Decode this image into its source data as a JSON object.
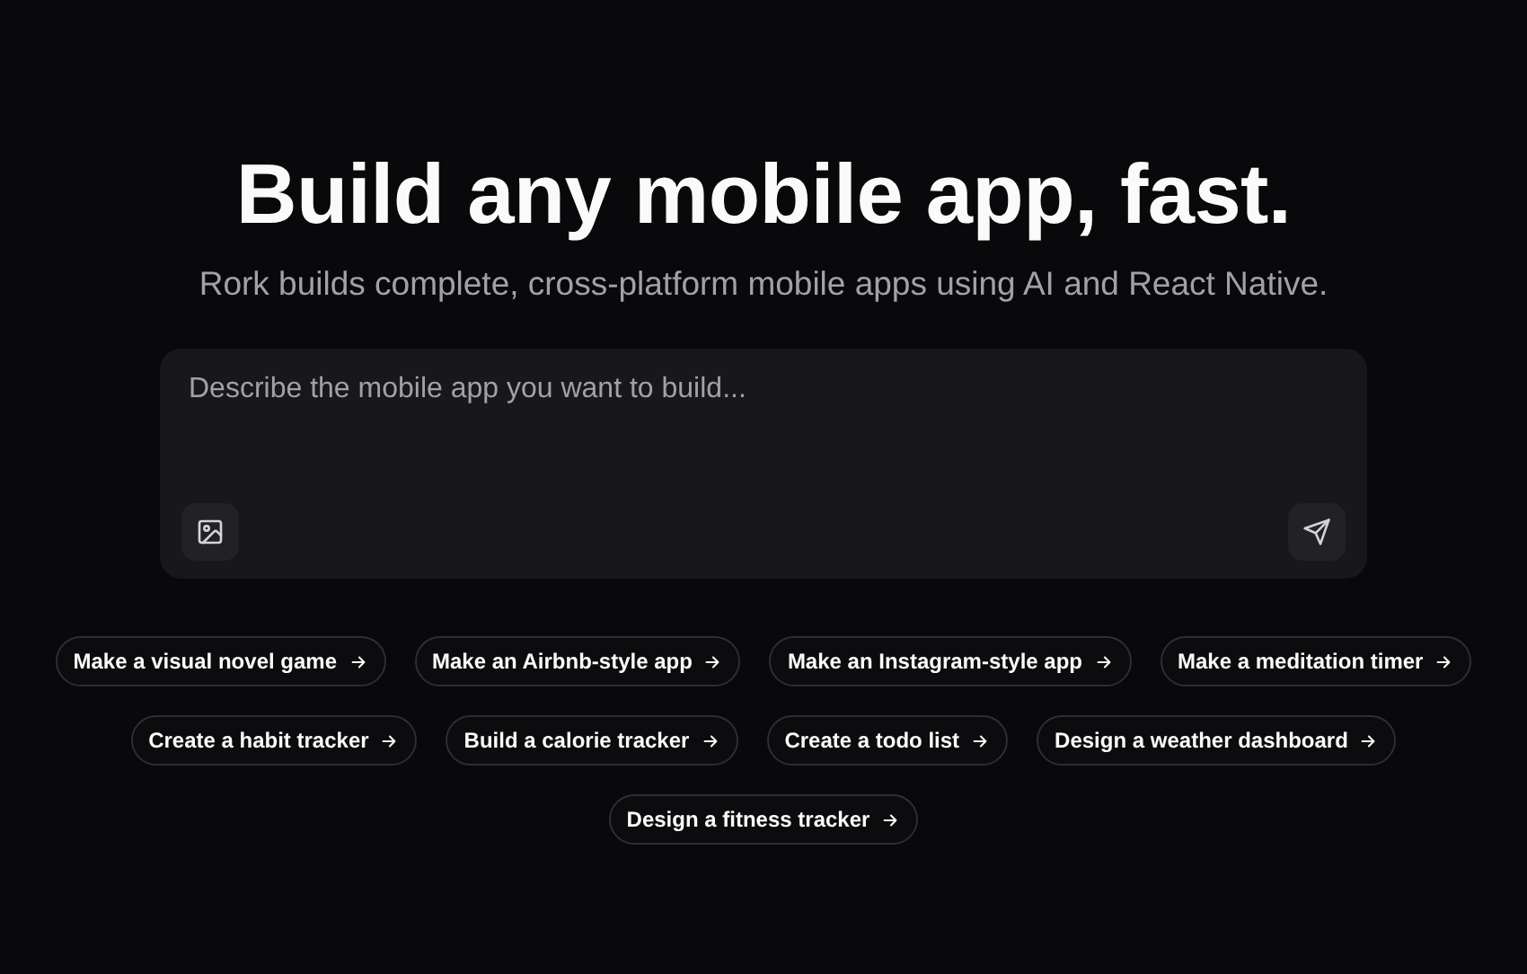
{
  "hero": {
    "title": "Build any mobile app, fast.",
    "subtitle": "Rork builds complete, cross-platform mobile apps using AI and React Native."
  },
  "prompt": {
    "placeholder": "Describe the mobile app you want to build..."
  },
  "suggestions": [
    {
      "label": "Make a visual novel game"
    },
    {
      "label": "Make an Airbnb-style app"
    },
    {
      "label": "Make an Instagram-style app"
    },
    {
      "label": "Make a meditation timer"
    },
    {
      "label": "Create a habit tracker"
    },
    {
      "label": "Build a calorie tracker"
    },
    {
      "label": "Create a todo list"
    },
    {
      "label": "Design a weather dashboard"
    },
    {
      "label": "Design a fitness tracker"
    }
  ]
}
